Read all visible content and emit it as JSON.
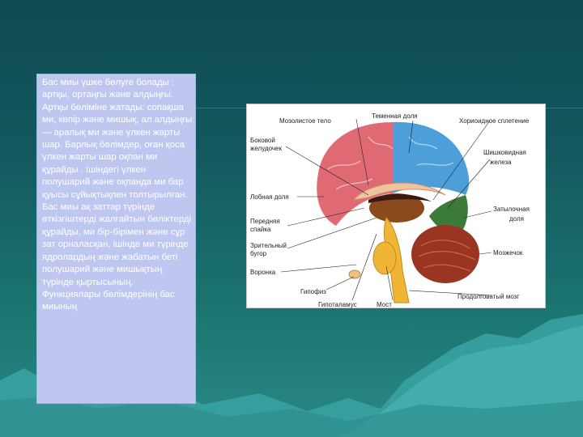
{
  "slide": {
    "body_text": "Бас миы үшке бөлуге болады : артқы, ортаңғы және алдыңғы. Артқы бөліміне жатады: сопақша ми, көпір және мишық, ал алдыңғы — аралық ми және үлкен жарты шар. Барлық бөлімдер, оған қоса үлкен жарты шар оқпан ми құрайды . Ішіндегі үлкен полушарий және оқпанда ми бар қуысы сұйықтықпен толтырылған. Бас миы  ақ заттар түрінде өткізгіштерді жалғайтын бөліктерді құрайды, ми бір-бірімен және сұр зат орналасқан, ішінде ми түрінде ядролардың және жабатын беті полушарий және мишықтың түрінде қыртысының. Функциялары бөлімдерінің бас миының"
  },
  "diagram": {
    "labels_left": {
      "mozol": "Мозолистое тело",
      "bokovoy_1": "Боковой",
      "bokovoy_2": "желудочек",
      "lobnaya": "Лобная доля",
      "perednyaya_1": "Передняя",
      "perednyaya_2": "спайка",
      "zritelny_1": "Зрительный",
      "zritelny_2": "бугор",
      "voronka": "Воронка",
      "gipofiz": "Гипофиз",
      "gipotalamus": "Гипоталамус"
    },
    "labels_top": {
      "temennaya": "Теменная доля"
    },
    "labels_right": {
      "horioidnoe": "Хориоидное сплетение",
      "shishko_1": "Шишковидная",
      "shishko_2": "железа",
      "zatylochnaya_1": "Затылочная",
      "zatylochnaya_2": "доля",
      "mozzhechok": "Мозжечок",
      "prodolg": "Продолговатый мозг"
    },
    "labels_bottom": {
      "most": "Мост"
    },
    "colors": {
      "frontal": "#e06a73",
      "parietal": "#4d9fd9",
      "occipital": "#3c7a3a",
      "corpus_callosum": "#f0c3a0",
      "thalamus": "#8a4a1e",
      "brainstem": "#f1b535",
      "cerebellum": "#9a3522",
      "ventricle": "#3a1a10"
    }
  }
}
